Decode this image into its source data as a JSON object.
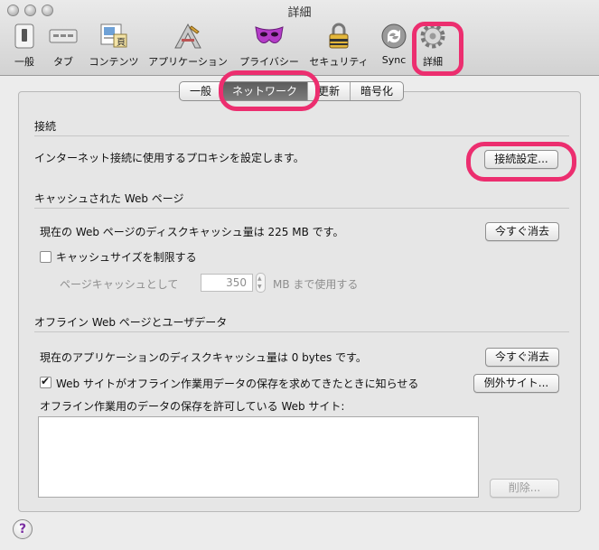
{
  "window": {
    "title": "詳細"
  },
  "toolbar": {
    "items": [
      {
        "label": "一般",
        "icon": "switch-icon"
      },
      {
        "label": "タブ",
        "icon": "tabs-icon"
      },
      {
        "label": "コンテンツ",
        "icon": "content-icon"
      },
      {
        "label": "アプリケーション",
        "icon": "applications-icon"
      },
      {
        "label": "プライバシー",
        "icon": "privacy-mask-icon"
      },
      {
        "label": "セキュリティ",
        "icon": "lock-icon"
      },
      {
        "label": "Sync",
        "icon": "sync-icon"
      },
      {
        "label": "詳細",
        "icon": "gear-icon"
      }
    ]
  },
  "tabs": {
    "items": [
      "一般",
      "ネットワーク",
      "更新",
      "暗号化"
    ],
    "active": "ネットワーク"
  },
  "connection": {
    "title": "接続",
    "description": "インターネット接続に使用するプロキシを設定します。",
    "settings_button": "接続設定..."
  },
  "cache": {
    "title": "キャッシュされた Web ページ",
    "status": "現在の Web ページのディスクキャッシュ量は 225 MB です。",
    "clear_button": "今すぐ消去",
    "limit_checkbox": "キャッシュサイズを制限する",
    "limit_checked": false,
    "limit_prefix": "ページキャッシュとして",
    "limit_value": "350",
    "limit_suffix": "MB まで使用する"
  },
  "offline": {
    "title": "オフライン Web ページとユーザデータ",
    "status": "現在のアプリケーションのディスクキャッシュ量は 0 bytes です。",
    "clear_button": "今すぐ消去",
    "notify_checkbox": "Web サイトがオフライン作業用データの保存を求めてきたときに知らせる",
    "notify_checked": true,
    "exceptions_button": "例外サイト...",
    "allowed_label": "オフライン作業用のデータの保存を許可している Web サイト:",
    "remove_button": "削除..."
  },
  "help": {
    "label": "?"
  },
  "colors": {
    "highlight": "#ec2e6f",
    "accent_purple": "#7a2ea2"
  }
}
